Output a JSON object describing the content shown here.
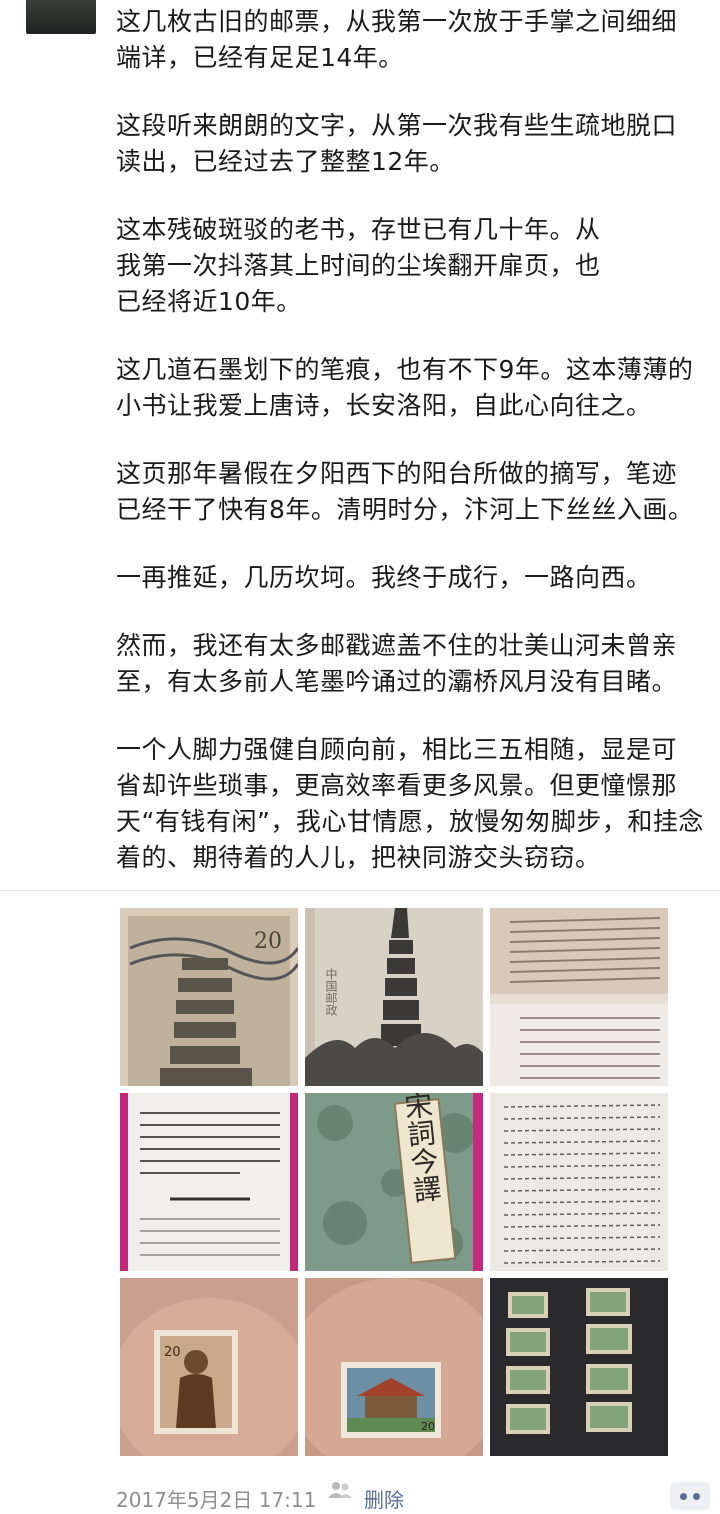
{
  "post": {
    "paragraphs": [
      "这几枚古旧的邮票，从我第一次放于手掌之间细细\n端详，已经有足足14年。",
      "这段听来朗朗的文字，从第一次我有些生疏地脱口\n读出，已经过去了整整12年。",
      "这本残破斑驳的老书，存世已有几十年。从\n我第一次抖落其上时间的尘埃翻开扉页，也\n已经将近10年。",
      "这几道石墨划下的笔痕，也有不下9年。这本薄薄的\n小书让我爱上唐诗，长安洛阳，自此心向往之。",
      "这页那年暑假在夕阳西下的阳台所做的摘写，笔迹\n已经干了快有8年。清明时分，汴河上下丝丝入画。",
      "一再推延，几历坎坷。我终于成行，一路向西。",
      "然而，我还有太多邮戳遮盖不住的壮美山河未曾亲\n至，有太多前人笔墨吟诵过的灞桥风月没有目睹。",
      "一个人脚力强健自顾向前，相比三五相随，显是可\n省却许些琐事，更高效率看更多风景。但更憧憬那\n天“有钱有闲”，我心甘情愿，放慢匆匆脚步，和挂念\n着的、期待着的人儿，把袂同游交头窃窃。"
    ]
  },
  "photos": {
    "stamp_value_1": "20",
    "stamp_country_2": "中国邮政",
    "book_title": "唐宋詞今譯",
    "stamp_value_7": "20",
    "stamp_value_8": "20"
  },
  "footer": {
    "timestamp": "2017年5月2日 17:11",
    "delete_label": "删除"
  },
  "colors": {
    "link": "#5a6e95",
    "meta": "#8e8e8e"
  }
}
